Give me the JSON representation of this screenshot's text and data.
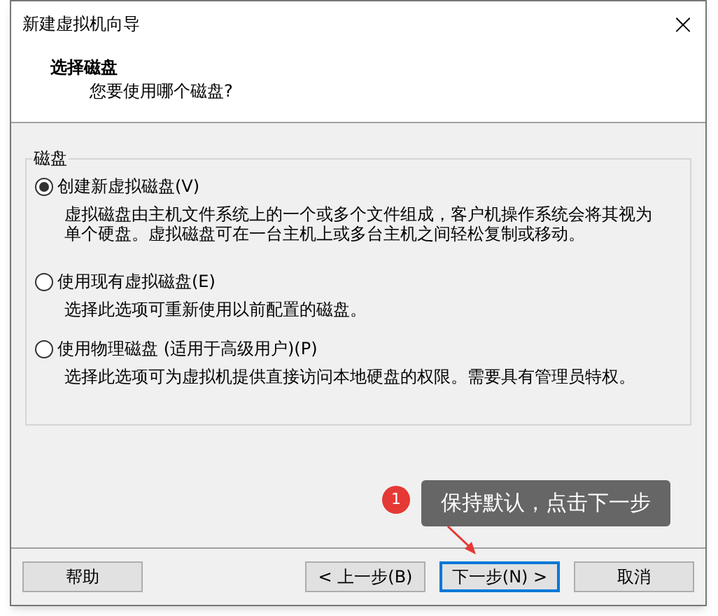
{
  "window": {
    "title": "新建虚拟机向导",
    "close": "×"
  },
  "header": {
    "title": "选择磁盘",
    "subtitle": "您要使用哪个磁盘?"
  },
  "group": {
    "title": "磁盘",
    "options": [
      {
        "label": "创建新虚拟磁盘(V)",
        "selected": true,
        "description": "虚拟磁盘由主机文件系统上的一个或多个文件组成，客户机操作系统会将其视为单个硬盘。虚拟磁盘可在一台主机上或多台主机之间轻松复制或移动。"
      },
      {
        "label": "使用现有虚拟磁盘(E)",
        "selected": false,
        "description": "选择此选项可重新使用以前配置的磁盘。"
      },
      {
        "label": "使用物理磁盘 (适用于高级用户)(P)",
        "selected": false,
        "description": "选择此选项可为虚拟机提供直接访问本地硬盘的权限。需要具有管理员特权。"
      }
    ]
  },
  "annotation": {
    "number": "1",
    "text": "保持默认，点击下一步"
  },
  "help_button": {
    "label": "帮助"
  },
  "buttons": [
    {
      "label": "< 上一步(B)",
      "focused": false
    },
    {
      "label": "下一步(N) >",
      "focused": true
    },
    {
      "label": "取消",
      "focused": false
    }
  ]
}
